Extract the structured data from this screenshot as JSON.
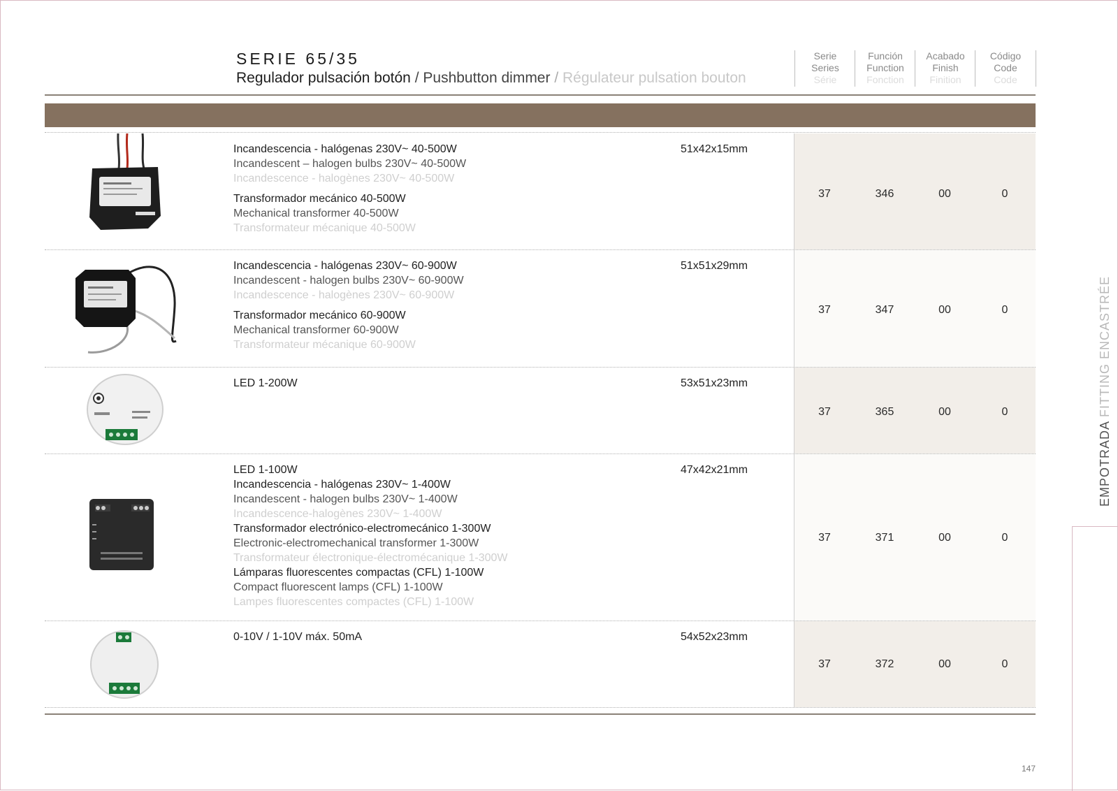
{
  "header": {
    "series_title": "SERIE 65/35",
    "subtitle_es": "Regulador pulsación botón",
    "separator": "/",
    "subtitle_en": "Pushbutton dimmer",
    "subtitle_fr": "Régulateur pulsation bouton"
  },
  "columns": [
    {
      "es": "Serie",
      "en": "Series",
      "fr": "Série"
    },
    {
      "es": "Función",
      "en": "Function",
      "fr": "Fonction"
    },
    {
      "es": "Acabado",
      "en": "Finish",
      "fr": "Finition"
    },
    {
      "es": "Código",
      "en": "Code",
      "fr": "Code"
    }
  ],
  "products": [
    {
      "dims": "51x42x15mm",
      "groups": [
        {
          "es": "Incandescencia - halógenas 230V~ 40-500W",
          "en": "Incandescent – halogen bulbs 230V~ 40-500W",
          "fr": "Incandescence - halogènes 230V~ 40-500W"
        },
        {
          "es": "Transformador mecánico 40-500W",
          "en": "Mechanical transformer 40-500W",
          "fr": "Transformateur mécanique 40-500W"
        }
      ],
      "codes": [
        "37",
        "346",
        "00",
        "0"
      ]
    },
    {
      "dims": "51x51x29mm",
      "groups": [
        {
          "es": "Incandescencia - halógenas 230V~ 60-900W",
          "en": "Incandescent - halogen bulbs 230V~ 60-900W",
          "fr": "Incandescence - halogènes 230V~ 60-900W"
        },
        {
          "es": "Transformador mecánico 60-900W",
          "en": "Mechanical transformer 60-900W",
          "fr": "Transformateur mécanique 60-900W"
        }
      ],
      "codes": [
        "37",
        "347",
        "00",
        "0"
      ]
    },
    {
      "dims": "53x51x23mm",
      "line": "LED 1-200W",
      "codes": [
        "37",
        "365",
        "00",
        "0"
      ]
    },
    {
      "dims": "47x42x21mm",
      "line": "LED 1-100W",
      "groups": [
        {
          "es": "Incandescencia - halógenas 230V~ 1-400W",
          "en": "Incandescent - halogen bulbs 230V~ 1-400W",
          "fr": "Incandescence-halogènes 230V~ 1-400W"
        },
        {
          "es": "Transformador electrónico-electromecánico 1-300W",
          "en": "Electronic-electromechanical transformer 1-300W",
          "fr": "Transformateur électronique-électromécanique 1-300W"
        },
        {
          "es": "Lámparas fluorescentes compactas (CFL) 1-100W",
          "en": "Compact fluorescent lamps (CFL) 1-100W",
          "fr": "Lampes fluorescentes compactes (CFL) 1-100W"
        }
      ],
      "codes": [
        "37",
        "371",
        "00",
        "0"
      ]
    },
    {
      "dims": "54x52x23mm",
      "line": "0-10V / 1-10V máx. 50mA",
      "codes": [
        "37",
        "372",
        "00",
        "0"
      ]
    }
  ],
  "side_tab": {
    "part1": "EMPOTRADA ",
    "part2": "FITTING ENCASTRÉE"
  },
  "page_number": "147",
  "colors": {
    "band": "#85715f",
    "rule": "#8a8177",
    "code_bg_alt": "#f2eee9",
    "frame": "#d9b9c2"
  }
}
